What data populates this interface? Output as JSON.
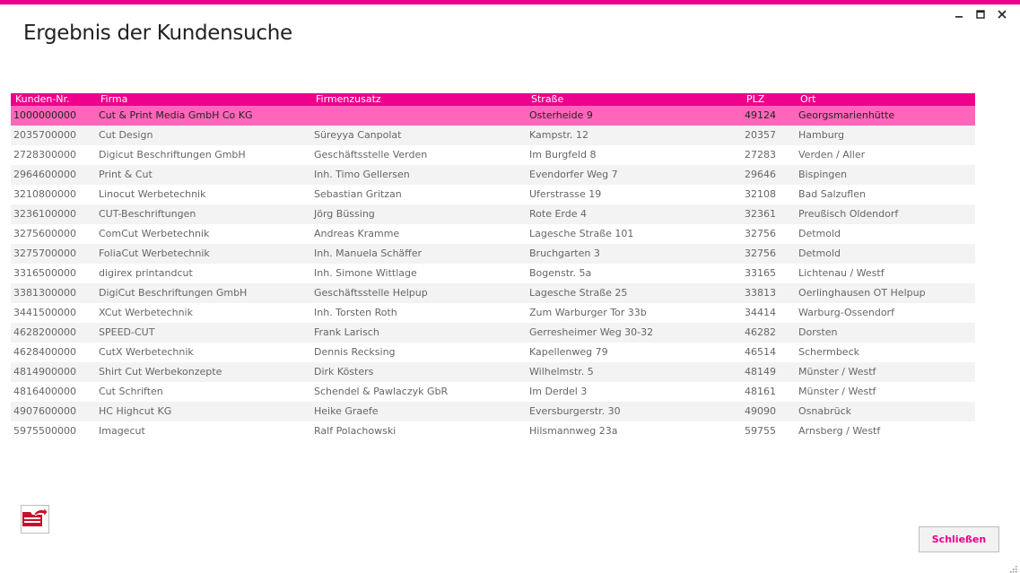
{
  "window": {
    "title": "Ergebnis der Kundensuche",
    "accent_color": "#ec008c",
    "controls": {
      "minimize_icon": "minimize-icon",
      "maximize_icon": "maximize-icon",
      "close_icon": "close-icon"
    }
  },
  "grid": {
    "columns": [
      "Kunden-Nr.",
      "Firma",
      "Firmenzusatz",
      "Straße",
      "PLZ",
      "Ort"
    ],
    "selected_row_index": 0,
    "selected_color": "#ff66bb",
    "rows": [
      [
        "1000000000",
        "Cut & Print Media GmbH Co KG",
        "",
        "Osterheide 9",
        "49124",
        "Georgsmarienhütte"
      ],
      [
        "2035700000",
        "Cut Design",
        "Süreyya Canpolat",
        "Kampstr. 12",
        "20357",
        "Hamburg"
      ],
      [
        "2728300000",
        "Digicut Beschriftungen GmbH",
        "Geschäftsstelle Verden",
        "Im Burgfeld 8",
        "27283",
        "Verden / Aller"
      ],
      [
        "2964600000",
        "Print & Cut",
        "Inh. Timo Gellersen",
        "Evendorfer Weg 7",
        "29646",
        "Bispingen"
      ],
      [
        "3210800000",
        "Linocut Werbetechnik",
        "Sebastian Gritzan",
        "Uferstrasse 19",
        "32108",
        "Bad Salzuflen"
      ],
      [
        "3236100000",
        "CUT-Beschriftungen",
        "Jörg Büssing",
        "Rote Erde 4",
        "32361",
        "Preußisch Oldendorf"
      ],
      [
        "3275600000",
        "ComCut Werbetechnik",
        "Andreas Kramme",
        "Lagesche Straße 101",
        "32756",
        "Detmold"
      ],
      [
        "3275700000",
        "FoliaCut Werbetechnik",
        "Inh. Manuela Schäffer",
        "Bruchgarten 3",
        "32756",
        "Detmold"
      ],
      [
        "3316500000",
        "digirex printandcut",
        "Inh. Simone Wittlage",
        "Bogenstr. 5a",
        "33165",
        "Lichtenau / Westf"
      ],
      [
        "3381300000",
        "DigiCut Beschriftungen GmbH",
        "Geschäftsstelle Helpup",
        "Lagesche Straße 25",
        "33813",
        "Oerlinghausen OT Helpup"
      ],
      [
        "3441500000",
        "XCut Werbetechnik",
        "Inh. Torsten Roth",
        "Zum Warburger Tor 33b",
        "34414",
        "Warburg-Ossendorf"
      ],
      [
        "4628200000",
        "SPEED-CUT",
        "Frank Larisch",
        "Gerresheimer Weg 30-32",
        "46282",
        "Dorsten"
      ],
      [
        "4628400000",
        "CutX Werbetechnik",
        "Dennis Recksing",
        "Kapellenweg 79",
        "46514",
        "Schermbeck"
      ],
      [
        "4814900000",
        "Shirt Cut Werbekonzepte",
        "Dirk Kösters",
        "Wilhelmstr. 5",
        "48149",
        "Münster / Westf"
      ],
      [
        "4816400000",
        "Cut Schriften",
        "Schendel & Pawlaczyk GbR",
        "Im Derdel 3",
        "48161",
        "Münster / Westf"
      ],
      [
        "4907600000",
        "HC Highcut KG",
        "Heike Graefe",
        "Eversburgerstr. 30",
        "49090",
        "Osnabrück"
      ],
      [
        "5975500000",
        "Imagecut",
        "Ralf Polachowski",
        "Hilsmannweg 23a",
        "59755",
        "Arnsberg / Westf"
      ]
    ]
  },
  "footer": {
    "export_icon": "folder-export-icon",
    "close_label": "Schließen"
  }
}
